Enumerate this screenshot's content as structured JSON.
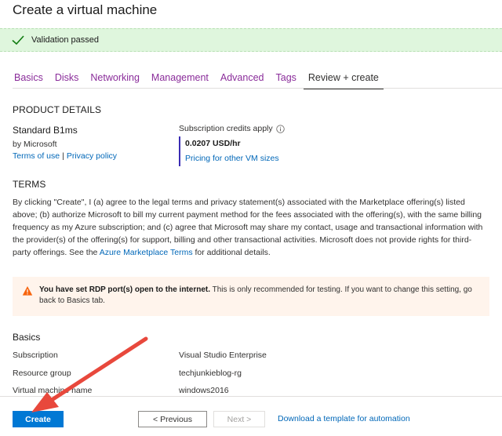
{
  "page": {
    "title": "Create a virtual machine"
  },
  "validation": {
    "text": "Validation passed",
    "color": "#dff6dd"
  },
  "tabs": [
    {
      "label": "Basics"
    },
    {
      "label": "Disks"
    },
    {
      "label": "Networking"
    },
    {
      "label": "Management"
    },
    {
      "label": "Advanced"
    },
    {
      "label": "Tags"
    },
    {
      "label": "Review + create",
      "active": true
    }
  ],
  "product": {
    "heading": "PRODUCT DETAILS",
    "name": "Standard B1ms",
    "by": "by Microsoft",
    "terms_link": "Terms of use",
    "separator": "|",
    "privacy_link": "Privacy policy",
    "credits_label": "Subscription credits apply",
    "price": "0.0207 USD/hr",
    "pricing_link": "Pricing for other VM sizes"
  },
  "terms": {
    "heading": "TERMS",
    "body": "By clicking \"Create\", I (a) agree to the legal terms and privacy statement(s) associated with the Marketplace offering(s) listed above; (b) authorize Microsoft to bill my current payment method for the fees associated with the offering(s), with the same billing frequency as my Azure subscription; and (c) agree that Microsoft may share my contact, usage and transactional information with the provider(s) of the offering(s) for support, billing and other transactional activities. Microsoft does not provide rights for third-party offerings. See the ",
    "link": "Azure Marketplace Terms",
    "suffix": " for additional details."
  },
  "warning": {
    "bold": "You have set RDP port(s) open to the internet.",
    "text": "  This is only recommended for testing.  If you want to change this setting, go back to Basics tab.",
    "color": "#fff4ec"
  },
  "basics": {
    "heading": "Basics",
    "rows": [
      {
        "label": "Subscription",
        "value": "Visual Studio Enterprise"
      },
      {
        "label": "Resource group",
        "value": "techjunkieblog-rg"
      },
      {
        "label": "Virtual machine name",
        "value": "windows2016"
      }
    ]
  },
  "footer": {
    "create": "Create",
    "previous": "< Previous",
    "next": "Next >",
    "download": "Download a template for automation"
  },
  "colors": {
    "accent": "#0078d4",
    "link": "#0067b8",
    "tab_link": "#8a2c9a",
    "arrow": "#e8483c"
  }
}
